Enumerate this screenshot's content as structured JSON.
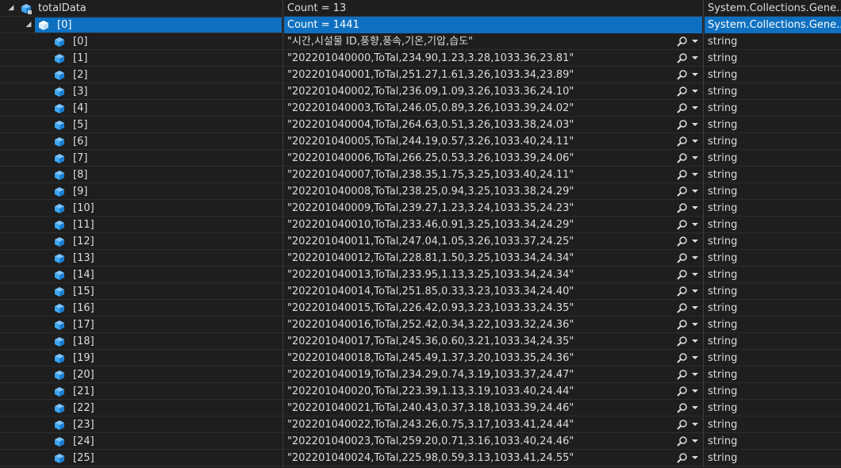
{
  "root": {
    "name": "totalData",
    "value": "Count = 13",
    "type": "System.Collections.Gene..."
  },
  "list": {
    "name": "[0]",
    "value": "Count = 1441",
    "type": "System.Collections.Gene..."
  },
  "items": [
    {
      "name": "[0]",
      "value": "\"시간,시설물 ID,풍향,풍속,기온,기압,습도\"",
      "type": "string"
    },
    {
      "name": "[1]",
      "value": "\"202201040000,ToTal,234.90,1.23,3.28,1033.36,23.81\"",
      "type": "string"
    },
    {
      "name": "[2]",
      "value": "\"202201040001,ToTal,251.27,1.61,3.26,1033.34,23.89\"",
      "type": "string"
    },
    {
      "name": "[3]",
      "value": "\"202201040002,ToTal,236.09,1.09,3.26,1033.36,24.10\"",
      "type": "string"
    },
    {
      "name": "[4]",
      "value": "\"202201040003,ToTal,246.05,0.89,3.26,1033.39,24.02\"",
      "type": "string"
    },
    {
      "name": "[5]",
      "value": "\"202201040004,ToTal,264.63,0.51,3.26,1033.38,24.03\"",
      "type": "string"
    },
    {
      "name": "[6]",
      "value": "\"202201040005,ToTal,244.19,0.57,3.26,1033.40,24.11\"",
      "type": "string"
    },
    {
      "name": "[7]",
      "value": "\"202201040006,ToTal,266.25,0.53,3.26,1033.39,24.06\"",
      "type": "string"
    },
    {
      "name": "[8]",
      "value": "\"202201040007,ToTal,238.35,1.75,3.25,1033.40,24.11\"",
      "type": "string"
    },
    {
      "name": "[9]",
      "value": "\"202201040008,ToTal,238.25,0.94,3.25,1033.38,24.29\"",
      "type": "string"
    },
    {
      "name": "[10]",
      "value": "\"202201040009,ToTal,239.27,1.23,3.24,1033.35,24.23\"",
      "type": "string"
    },
    {
      "name": "[11]",
      "value": "\"202201040010,ToTal,233.46,0.91,3.25,1033.34,24.29\"",
      "type": "string"
    },
    {
      "name": "[12]",
      "value": "\"202201040011,ToTal,247.04,1.05,3.26,1033.37,24.25\"",
      "type": "string"
    },
    {
      "name": "[13]",
      "value": "\"202201040012,ToTal,228.81,1.50,3.25,1033.34,24.34\"",
      "type": "string"
    },
    {
      "name": "[14]",
      "value": "\"202201040013,ToTal,233.95,1.13,3.25,1033.34,24.34\"",
      "type": "string"
    },
    {
      "name": "[15]",
      "value": "\"202201040014,ToTal,251.85,0.33,3.23,1033.34,24.40\"",
      "type": "string"
    },
    {
      "name": "[16]",
      "value": "\"202201040015,ToTal,226.42,0.93,3.23,1033.33,24.35\"",
      "type": "string"
    },
    {
      "name": "[17]",
      "value": "\"202201040016,ToTal,252.42,0.34,3.22,1033.32,24.36\"",
      "type": "string"
    },
    {
      "name": "[18]",
      "value": "\"202201040017,ToTal,245.36,0.60,3.21,1033.34,24.35\"",
      "type": "string"
    },
    {
      "name": "[19]",
      "value": "\"202201040018,ToTal,245.49,1.37,3.20,1033.35,24.36\"",
      "type": "string"
    },
    {
      "name": "[20]",
      "value": "\"202201040019,ToTal,234.29,0.74,3.19,1033.37,24.47\"",
      "type": "string"
    },
    {
      "name": "[21]",
      "value": "\"202201040020,ToTal,223.39,1.13,3.19,1033.40,24.44\"",
      "type": "string"
    },
    {
      "name": "[22]",
      "value": "\"202201040021,ToTal,240.43,0.37,3.18,1033.39,24.46\"",
      "type": "string"
    },
    {
      "name": "[23]",
      "value": "\"202201040022,ToTal,243.26,0.75,3.17,1033.41,24.44\"",
      "type": "string"
    },
    {
      "name": "[24]",
      "value": "\"202201040023,ToTal,259.20,0.71,3.16,1033.40,24.46\"",
      "type": "string"
    },
    {
      "name": "[25]",
      "value": "\"202201040024,ToTal,225.98,0.59,3.13,1033.41,24.55\"",
      "type": "string"
    }
  ],
  "colors": {
    "selection": "#0e70c0",
    "background": "#1e1e1e",
    "cube": "#3ea8f5"
  },
  "icons": {
    "expand": "triangle-expanded-icon",
    "object": "cube-icon",
    "visualizer": "magnifier-icon"
  }
}
